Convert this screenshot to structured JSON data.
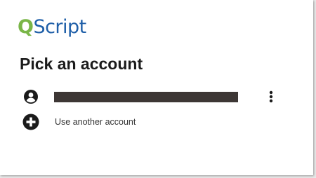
{
  "brand": {
    "logo_q": "Q",
    "logo_rest": "Script",
    "colors": {
      "q": "#7ab648",
      "script": "#1f5fa8"
    }
  },
  "title": "Pick an account",
  "accounts": [
    {
      "icon": "account-circle-icon",
      "name_masked": true,
      "more_icon": "more-vertical-icon"
    }
  ],
  "use_another": {
    "icon": "add-circle-icon",
    "label": "Use another account"
  },
  "colors": {
    "text": "#1b1b1b",
    "icon": "#1b1b1b",
    "mask": "#3d3735"
  }
}
